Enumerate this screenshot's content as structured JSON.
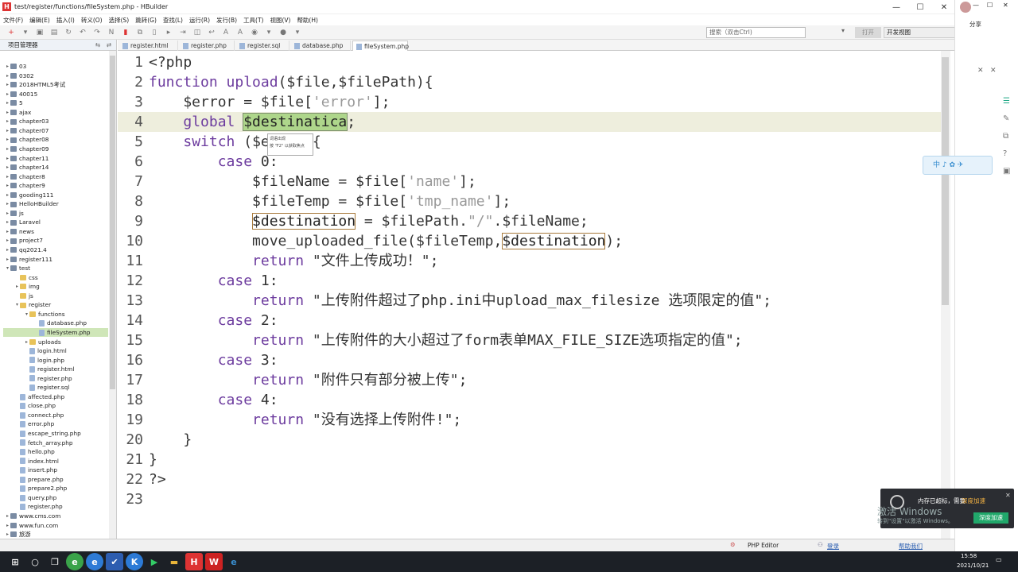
{
  "window": {
    "title": "test/register/functions/fileSystem.php  -  HBuilder"
  },
  "menu": [
    "文件(F)",
    "编辑(E)",
    "插入(I)",
    "转义(O)",
    "选择(S)",
    "跳转(G)",
    "查找(L)",
    "运行(R)",
    "发行(B)",
    "工具(T)",
    "视图(V)",
    "帮助(H)"
  ],
  "search": {
    "placeholder": "搜索（双击Ctrl)"
  },
  "open_button": "打开",
  "perspective": "开发视图",
  "sidebar": {
    "title": "项目管理器",
    "items": [
      {
        "label": "03",
        "depth": 0,
        "kind": "proj",
        "tw": "▸"
      },
      {
        "label": "0302",
        "depth": 0,
        "kind": "proj",
        "tw": "▸"
      },
      {
        "label": "2018HTML5考试",
        "depth": 0,
        "kind": "proj",
        "tw": "▸"
      },
      {
        "label": "40015",
        "depth": 0,
        "kind": "proj",
        "tw": "▸"
      },
      {
        "label": "5",
        "depth": 0,
        "kind": "proj",
        "tw": "▸"
      },
      {
        "label": "ajax",
        "depth": 0,
        "kind": "proj",
        "tw": "▸"
      },
      {
        "label": "chapter03",
        "depth": 0,
        "kind": "proj",
        "tw": "▸"
      },
      {
        "label": "chapter07",
        "depth": 0,
        "kind": "proj",
        "tw": "▸"
      },
      {
        "label": "chapter08",
        "depth": 0,
        "kind": "proj",
        "tw": "▸"
      },
      {
        "label": "chapter09",
        "depth": 0,
        "kind": "proj",
        "tw": "▸"
      },
      {
        "label": "chapter11",
        "depth": 0,
        "kind": "proj",
        "tw": "▸"
      },
      {
        "label": "chapter14",
        "depth": 0,
        "kind": "proj",
        "tw": "▸"
      },
      {
        "label": "chapter8",
        "depth": 0,
        "kind": "proj",
        "tw": "▸"
      },
      {
        "label": "chapter9",
        "depth": 0,
        "kind": "proj",
        "tw": "▸"
      },
      {
        "label": "gooding111",
        "depth": 0,
        "kind": "proj",
        "tw": "▸"
      },
      {
        "label": "HelloHBuilder",
        "depth": 0,
        "kind": "proj",
        "tw": "▸"
      },
      {
        "label": "js",
        "depth": 0,
        "kind": "proj",
        "tw": "▸"
      },
      {
        "label": "Laravel",
        "depth": 0,
        "kind": "proj",
        "tw": "▸"
      },
      {
        "label": "news",
        "depth": 0,
        "kind": "proj",
        "tw": "▸"
      },
      {
        "label": "project7",
        "depth": 0,
        "kind": "proj",
        "tw": "▸"
      },
      {
        "label": "qq2021.4",
        "depth": 0,
        "kind": "proj",
        "tw": "▸"
      },
      {
        "label": "register111",
        "depth": 0,
        "kind": "proj",
        "tw": "▸"
      },
      {
        "label": "test",
        "depth": 0,
        "kind": "proj",
        "tw": "▾"
      },
      {
        "label": "css",
        "depth": 1,
        "kind": "folder",
        "tw": ""
      },
      {
        "label": "img",
        "depth": 1,
        "kind": "folder",
        "tw": "▸"
      },
      {
        "label": "js",
        "depth": 1,
        "kind": "folder",
        "tw": ""
      },
      {
        "label": "register",
        "depth": 1,
        "kind": "folder",
        "tw": "▾"
      },
      {
        "label": "functions",
        "depth": 2,
        "kind": "folder",
        "tw": "▾"
      },
      {
        "label": "database.php",
        "depth": 3,
        "kind": "file",
        "tw": ""
      },
      {
        "label": "fileSystem.php",
        "depth": 3,
        "kind": "file",
        "tw": "",
        "selected": true
      },
      {
        "label": "uploads",
        "depth": 2,
        "kind": "folder",
        "tw": "▸"
      },
      {
        "label": "login.html",
        "depth": 2,
        "kind": "file",
        "tw": ""
      },
      {
        "label": "login.php",
        "depth": 2,
        "kind": "file",
        "tw": ""
      },
      {
        "label": "register.html",
        "depth": 2,
        "kind": "file",
        "tw": ""
      },
      {
        "label": "register.php",
        "depth": 2,
        "kind": "file",
        "tw": ""
      },
      {
        "label": "register.sql",
        "depth": 2,
        "kind": "file",
        "tw": ""
      },
      {
        "label": "affected.php",
        "depth": 1,
        "kind": "file",
        "tw": ""
      },
      {
        "label": "close.php",
        "depth": 1,
        "kind": "file",
        "tw": ""
      },
      {
        "label": "connect.php",
        "depth": 1,
        "kind": "file",
        "tw": ""
      },
      {
        "label": "error.php",
        "depth": 1,
        "kind": "file",
        "tw": ""
      },
      {
        "label": "escape_string.php",
        "depth": 1,
        "kind": "file",
        "tw": ""
      },
      {
        "label": "fetch_array.php",
        "depth": 1,
        "kind": "file",
        "tw": ""
      },
      {
        "label": "hello.php",
        "depth": 1,
        "kind": "file",
        "tw": ""
      },
      {
        "label": "index.html",
        "depth": 1,
        "kind": "file",
        "tw": ""
      },
      {
        "label": "insert.php",
        "depth": 1,
        "kind": "file",
        "tw": ""
      },
      {
        "label": "prepare.php",
        "depth": 1,
        "kind": "file",
        "tw": ""
      },
      {
        "label": "prepare2.php",
        "depth": 1,
        "kind": "file",
        "tw": ""
      },
      {
        "label": "query.php",
        "depth": 1,
        "kind": "file",
        "tw": ""
      },
      {
        "label": "register.php",
        "depth": 1,
        "kind": "file",
        "tw": ""
      },
      {
        "label": "www.cms.com",
        "depth": 0,
        "kind": "proj",
        "tw": "▸"
      },
      {
        "label": "www.fun.com",
        "depth": 0,
        "kind": "proj",
        "tw": "▸"
      },
      {
        "label": "旅游",
        "depth": 0,
        "kind": "proj",
        "tw": "▸"
      }
    ]
  },
  "tabs": [
    "register.html",
    "register.php",
    "register.sql",
    "database.php",
    "fileSystem.php"
  ],
  "active_tab": 4,
  "code": [
    {
      "n": "1",
      "t": [
        [
          "plain",
          "<?php"
        ]
      ]
    },
    {
      "n": "2",
      "t": [
        [
          "kw",
          "function "
        ],
        [
          "fn",
          "upload"
        ],
        [
          "plain",
          "($file,$filePath){"
        ]
      ]
    },
    {
      "n": "3",
      "t": [
        [
          "plain",
          "    $error = $file["
        ],
        [
          "str",
          "'error'"
        ],
        [
          "plain",
          "];"
        ]
      ]
    },
    {
      "n": "4",
      "hl": true,
      "t": [
        [
          "plain",
          "    "
        ],
        [
          "kw",
          "global "
        ],
        [
          "sel",
          "$destinatica"
        ],
        [
          "plain",
          ";"
        ]
      ]
    },
    {
      "n": "5",
      "t": [
        [
          "plain",
          "    "
        ],
        [
          "kw",
          "switch"
        ],
        [
          "plain",
          " ($error){"
        ]
      ]
    },
    {
      "n": "6",
      "t": [
        [
          "plain",
          "        "
        ],
        [
          "kw",
          "case "
        ],
        [
          "plain",
          "0:"
        ]
      ]
    },
    {
      "n": "7",
      "t": [
        [
          "plain",
          "            $fileName = $file["
        ],
        [
          "str",
          "'name'"
        ],
        [
          "plain",
          "];"
        ]
      ]
    },
    {
      "n": "8",
      "t": [
        [
          "plain",
          "            $fileTemp = $file["
        ],
        [
          "str",
          "'tmp_name'"
        ],
        [
          "plain",
          "];"
        ]
      ]
    },
    {
      "n": "9",
      "t": [
        [
          "plain",
          "            "
        ],
        [
          "box",
          "$destination"
        ],
        [
          "plain",
          " = $filePath."
        ],
        [
          "str",
          "\"/\""
        ],
        [
          "plain",
          ".$fileName;"
        ]
      ]
    },
    {
      "n": "10",
      "t": [
        [
          "plain",
          "            move_uploaded_file($fileTemp,"
        ],
        [
          "box",
          "$destination"
        ],
        [
          "plain",
          ");"
        ]
      ]
    },
    {
      "n": "11",
      "t": [
        [
          "plain",
          "            "
        ],
        [
          "kw",
          "return "
        ],
        [
          "plain",
          "\"文件上传成功！\";"
        ]
      ]
    },
    {
      "n": "12",
      "t": [
        [
          "plain",
          "        "
        ],
        [
          "kw",
          "case "
        ],
        [
          "plain",
          "1:"
        ]
      ]
    },
    {
      "n": "13",
      "t": [
        [
          "plain",
          "            "
        ],
        [
          "kw",
          "return "
        ],
        [
          "plain",
          "\"上传附件超过了php.ini中upload_max_filesize 选项限定的值\";"
        ]
      ]
    },
    {
      "n": "14",
      "t": [
        [
          "plain",
          "        "
        ],
        [
          "kw",
          "case "
        ],
        [
          "plain",
          "2:"
        ]
      ]
    },
    {
      "n": "15",
      "t": [
        [
          "plain",
          "            "
        ],
        [
          "kw",
          "return "
        ],
        [
          "plain",
          "\"上传附件的大小超过了form表单MAX_FILE_SIZE选项指定的值\";"
        ]
      ]
    },
    {
      "n": "16",
      "t": [
        [
          "plain",
          "        "
        ],
        [
          "kw",
          "case "
        ],
        [
          "plain",
          "3:"
        ]
      ]
    },
    {
      "n": "17",
      "t": [
        [
          "plain",
          "            "
        ],
        [
          "kw",
          "return "
        ],
        [
          "plain",
          "\"附件只有部分被上传\";"
        ]
      ]
    },
    {
      "n": "18",
      "t": [
        [
          "plain",
          "        "
        ],
        [
          "kw",
          "case "
        ],
        [
          "plain",
          "4:"
        ]
      ]
    },
    {
      "n": "19",
      "t": [
        [
          "plain",
          "            "
        ],
        [
          "kw",
          "return "
        ],
        [
          "plain",
          "\"没有选择上传附件!\";"
        ]
      ]
    },
    {
      "n": "20",
      "t": [
        [
          "plain",
          "    }"
        ]
      ]
    },
    {
      "n": "21",
      "t": [
        [
          "plain",
          "}"
        ]
      ]
    },
    {
      "n": "22",
      "t": [
        [
          "plain",
          "?>"
        ]
      ]
    },
    {
      "n": "23",
      "t": []
    }
  ],
  "tooltip": {
    "line1": "词语出现",
    "line2": "按 \"F2\" 以获取焦点"
  },
  "status": {
    "mode": "PHP Editor",
    "login": "登录",
    "help": "帮助我们"
  },
  "notify": {
    "title": "内存已超标，需要",
    "action": "深度加速",
    "watermark1": "激活 Windows",
    "watermark2": "转到\"设置\"以激活 Windows。",
    "button": "深度加速"
  },
  "widget": {
    "label": "中 ♪ ✿ ✈"
  },
  "right_panel": {
    "share": "分享"
  },
  "clock": {
    "time": "15:58",
    "date": "2021/10/21"
  }
}
